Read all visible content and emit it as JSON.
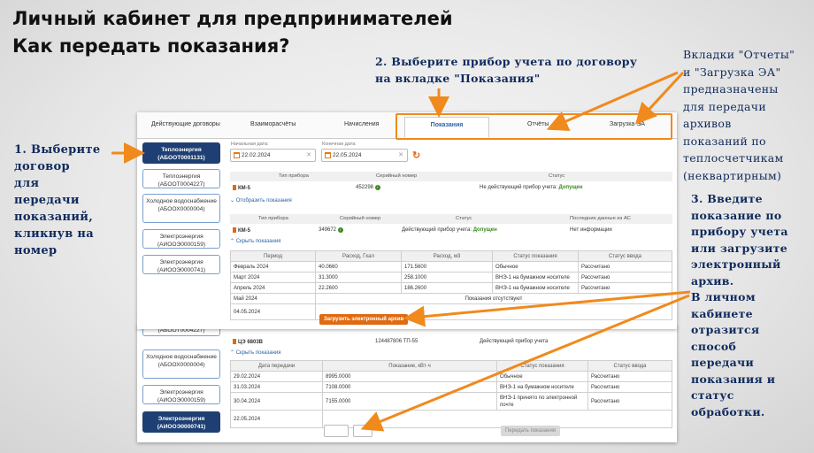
{
  "title": {
    "line1": "Личный кабинет для предпринимателей",
    "line2": "Как передать показания?"
  },
  "notes": {
    "step1": [
      "1. Выберите",
      "договор",
      "для",
      "передачи",
      "показаний,",
      "кликнув на",
      "номер"
    ],
    "step2": [
      "2. Выберите прибор учета по договору",
      "на вкладке \"Показания\""
    ],
    "tabs_note": [
      "Вкладки \"Отчеты\"",
      "и \"Загрузка ЭА\"",
      "предназначены",
      "для передачи",
      "архивов",
      "показаний по",
      "теплосчетчикам",
      "(неквартирным)"
    ],
    "step3": [
      "3. Введите",
      "показание по",
      "прибору учета",
      "или загрузите",
      "электронный",
      "архив."
    ],
    "step3b": [
      "В личном",
      "кабинете",
      "отразится",
      "способ",
      "передачи",
      "показания и",
      "статус",
      "обработки."
    ]
  },
  "tabs": [
    "Действующие договоры",
    "Взаиморасчёты",
    "Начисления",
    "Показания",
    "Отчёты",
    "Загрузка ЭА"
  ],
  "contracts_top": [
    {
      "name": "Теплоэнергия",
      "num": "(АБООТ0001131)"
    },
    {
      "name": "Теплоэнергия",
      "num": "(АБООТ0004227)"
    },
    {
      "name": "Холодное водоснабжение",
      "num": "(АБООХ0000004)"
    },
    {
      "name": "Электроэнергия",
      "num": "(АИООЭ0000159)"
    },
    {
      "name": "Электроэнергия",
      "num": "(АИООЭ0000741)"
    }
  ],
  "contracts_bottom": [
    {
      "num": "(АБООТ0004227)"
    },
    {
      "name": "Холодное водоснабжение",
      "num": "(АБООХ0000004)"
    },
    {
      "name": "Электроэнергия",
      "num": "(АИООЭ0000159)"
    },
    {
      "name": "Электроэнергия",
      "num": "(АИООЭ0000741)"
    }
  ],
  "filters": {
    "start_label": "Начальная дата:",
    "start": "22.02.2024",
    "end_label": "Конечная дата:",
    "end": "22.05.2024"
  },
  "device_table1": {
    "headers": [
      "Тип прибора",
      "Серийный номер",
      "Статус"
    ],
    "row": {
      "type": "КМ-5",
      "serial": "452298",
      "status_prefix": "Не действующий прибор учета:",
      "status": "Допущен"
    },
    "toggle": "Отобразить показания"
  },
  "device_table2": {
    "headers": [
      "Тип прибора",
      "Серийный номер",
      "Статус",
      "Последние данные из АС"
    ],
    "row": {
      "type": "КМ-5",
      "serial": "349672",
      "status_prefix": "Действующий прибор учета:",
      "status": "Допущен",
      "last": "Нет информации"
    },
    "toggle": "Скрыть показания"
  },
  "readings1": {
    "headers": [
      "Период",
      "Расход, Гкал",
      "Расход, м3",
      "Статус показания",
      "Статус ввода"
    ],
    "rows": [
      [
        "Февраль 2024",
        "40.0660",
        "171.5600",
        "Обычное",
        "Рассчитано"
      ],
      [
        "Март 2024",
        "31.3000",
        "258.1000",
        "ВНЭ-1 на бумажном носителе",
        "Рассчитано"
      ],
      [
        "Апрель 2024",
        "22.2600",
        "186.2600",
        "ВНЭ-1 на бумажном носителе",
        "Рассчитано"
      ]
    ],
    "may_label": "Май 2024",
    "absent": "Показания отсутствуют",
    "date_row": "04.05.2024",
    "upload": "Загрузить электронный архив"
  },
  "device_table3": {
    "row": {
      "type": "ЦЭ 6803В",
      "serial": "124487806 ТП-55",
      "status": "Действующий прибор учета"
    },
    "toggle": "Скрыть показания"
  },
  "readings2": {
    "headers": [
      "Дата передачи",
      "Показание, кВт·ч",
      "Статус показания",
      "Статус ввода"
    ],
    "rows": [
      [
        "29.02.2024",
        "8995.0000",
        "Обычное",
        "Рассчитано"
      ],
      [
        "31.03.2024",
        "7108.0000",
        "ВНЭ-1 на бумажном носителе",
        "Рассчитано"
      ],
      [
        "30.04.2024",
        "7155.0000",
        "ВНЭ-1 принято по электронной почте",
        "Рассчитано"
      ]
    ],
    "date_row": "22.05.2024",
    "submit": "Передать показания"
  },
  "colors": {
    "accent": "#f08a1c",
    "navy": "#1e3f73",
    "text_blue": "#0f2a5c"
  }
}
